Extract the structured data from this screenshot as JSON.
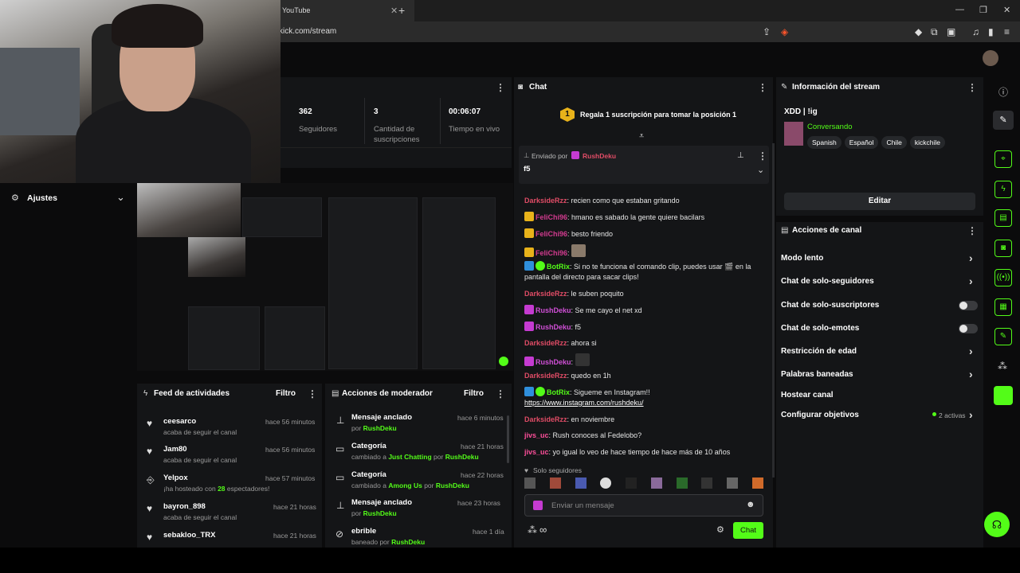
{
  "browser": {
    "tab_title": "YouTube",
    "url": "kick.com/stream"
  },
  "sidebar": {
    "settings_label": "Ajustes"
  },
  "stats": [
    {
      "value": "362",
      "label": "Seguidores"
    },
    {
      "value": "3",
      "label": "Cantidad de suscripciones"
    },
    {
      "value": "00:06:07",
      "label": "Tiempo en vivo"
    }
  ],
  "feed": {
    "title": "Feed de actividades",
    "filter": "Filtro",
    "items": [
      {
        "icon": "heart-icon",
        "name": "ceesarco",
        "sub": "acaba de seguir el canal",
        "time": "hace 56 minutos"
      },
      {
        "icon": "heart-icon",
        "name": "Jam80",
        "sub": "acaba de seguir el canal",
        "time": "hace 56 minutos"
      },
      {
        "icon": "host-icon",
        "name": "Yelpox",
        "sub_pre": "¡ha hosteado con",
        "sub_num": "28",
        "sub_post": "espectadores!",
        "time": "hace 57 minutos"
      },
      {
        "icon": "heart-icon",
        "name": "bayron_898",
        "sub": "acaba de seguir el canal",
        "time": "hace 21 horas"
      },
      {
        "icon": "heart-icon",
        "name": "sebakloo_TRX",
        "sub": "",
        "time": "hace 21 horas"
      }
    ]
  },
  "mod": {
    "title": "Acciones de moderador",
    "filter": "Filtro",
    "items": [
      {
        "icon": "pin-icon",
        "title": "Mensaje anclado",
        "sub_pre": "por",
        "user": "RushDeku",
        "time": "hace 6 minutos"
      },
      {
        "icon": "category-icon",
        "title": "Categoría",
        "sub_pre": "cambiado a",
        "target": "Just Chatting",
        "sub_mid": "por",
        "user": "RushDeku",
        "time": "hace 21 horas"
      },
      {
        "icon": "category-icon",
        "title": "Categoría",
        "sub_pre": "cambiado a",
        "target": "Among Us",
        "sub_mid": "por",
        "user": "RushDeku",
        "time": "hace 22 horas"
      },
      {
        "icon": "pin-icon",
        "title": "Mensaje anclado",
        "sub_pre": "por",
        "user": "RushDeku",
        "time": "hace 23 horas"
      },
      {
        "icon": "ban-icon",
        "title": "ebrible",
        "sub_pre": "baneado por",
        "user": "RushDeku",
        "time": "hace 1 día"
      }
    ]
  },
  "chat": {
    "title": "Chat",
    "sub_goal_num": "1",
    "sub_goal_text": "Regala 1 suscripción para tomar la posición 1",
    "pinned_by_label": "Enviado por",
    "pinned_user": "RushDeku",
    "pinned_text": "f5",
    "messages": [
      {
        "user": "DarksideRzz",
        "cls": "uname-r",
        "text": "recien como que estaban gritando"
      },
      {
        "user": "FeliChi96",
        "cls": "uname-m",
        "badge": "crown",
        "text": "hmano es sabado la gente quiere bacilars"
      },
      {
        "user": "FeliChi96",
        "cls": "uname-m",
        "badge": "crown",
        "text": "besto friendo"
      },
      {
        "user": "FeliChi96",
        "cls": "uname-m",
        "badge": "crown",
        "text": ""
      },
      {
        "user": "BotRix",
        "cls": "uname-b",
        "badge": "bot",
        "text": "Si no te funciona el comando clip, puedes usar 🎬 en la pantalla del directo para sacar clips!"
      },
      {
        "user": "DarksideRzz",
        "cls": "uname-r",
        "text": "le suben poquito"
      },
      {
        "user": "RushDeku",
        "cls": "uname-p",
        "badge": "mic",
        "text": "Se me cayo el net xd"
      },
      {
        "user": "RushDeku",
        "cls": "uname-p",
        "badge": "mic",
        "text": "f5"
      },
      {
        "user": "DarksideRzz",
        "cls": "uname-r",
        "text": "ahora si"
      },
      {
        "user": "RushDeku",
        "cls": "uname-p",
        "badge": "mic",
        "text": ""
      },
      {
        "user": "DarksideRzz",
        "cls": "uname-r",
        "text": "quedo en 1h"
      },
      {
        "user": "BotRix",
        "cls": "uname-b",
        "badge": "bot",
        "text": "Sigueme en Instagram!!",
        "link": "https://www.instagram.com/rushdeku/"
      },
      {
        "user": "DarksideRzz",
        "cls": "uname-r",
        "text": "en noviembre"
      },
      {
        "user": "jivs_uc",
        "cls": "uname-pk",
        "text": "Rush conoces al Fedelobo?"
      },
      {
        "user": "jivs_uc",
        "cls": "uname-pk",
        "text": "yo igual lo veo de hace tiempo de hace más de 10 años"
      }
    ],
    "followers_only": "Solo seguidores",
    "input_placeholder": "Enviar un mensaje",
    "send_label": "Chat"
  },
  "info": {
    "title": "Información del stream",
    "stream_title": "XDD | !ig",
    "category": "Conversando",
    "tags": [
      "Spanish",
      "Español",
      "Chile",
      "kickchile"
    ],
    "edit_label": "Editar"
  },
  "channel": {
    "title": "Acciones de canal",
    "rows": [
      {
        "label": "Modo lento",
        "control": "chevron"
      },
      {
        "label": "Chat de solo-seguidores",
        "control": "chevron"
      },
      {
        "label": "Chat de solo-suscriptores",
        "control": "toggle"
      },
      {
        "label": "Chat de solo-emotes",
        "control": "toggle"
      },
      {
        "label": "Restricción de edad",
        "control": "chevron"
      },
      {
        "label": "Palabras baneadas",
        "control": "chevron"
      },
      {
        "label": "Hostear canal",
        "control": "none"
      },
      {
        "label": "Configurar objetivos",
        "control": "chevron",
        "extra": "2 activas"
      }
    ]
  },
  "colors": {
    "accent": "#53fc18",
    "panel": "#141517",
    "bg": "#0b0b0c"
  }
}
